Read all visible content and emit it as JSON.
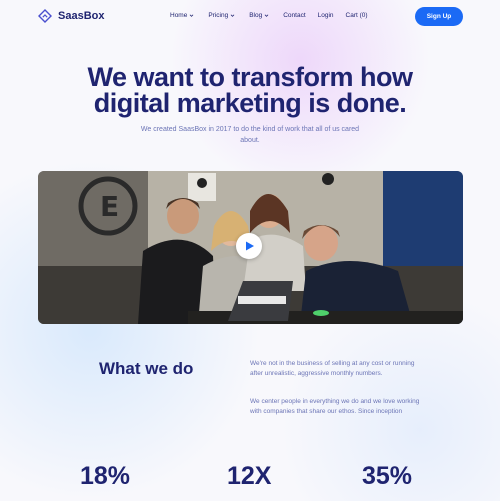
{
  "brand": {
    "name": "SaasBox"
  },
  "nav": {
    "items": [
      {
        "label": "Home",
        "has_dropdown": true
      },
      {
        "label": "Pricing",
        "has_dropdown": true
      },
      {
        "label": "Blog",
        "has_dropdown": true
      },
      {
        "label": "Contact",
        "has_dropdown": false
      },
      {
        "label": "Login",
        "has_dropdown": false
      },
      {
        "label": "Cart (0)",
        "has_dropdown": false
      }
    ],
    "signup_label": "Sign Up"
  },
  "hero": {
    "title_line1": "We want to transform how",
    "title_line2": "digital marketing is done.",
    "subtitle": "We created SaasBox in 2017 to do the kind of work that all of us cared about."
  },
  "video": {
    "play_icon": "play-icon"
  },
  "what_we_do": {
    "title": "What we do",
    "paragraph1": "We're not in the business of selling at any cost or running after unrealistic, aggressive monthly numbers.",
    "paragraph2": "We center people in everything we do and we love working with companies that share our ethos. Since inception"
  },
  "stats": [
    "18%",
    "12X",
    "35%"
  ],
  "colors": {
    "accent": "#1b6af5",
    "heading": "#1f2470",
    "muted": "#6c75b6"
  }
}
